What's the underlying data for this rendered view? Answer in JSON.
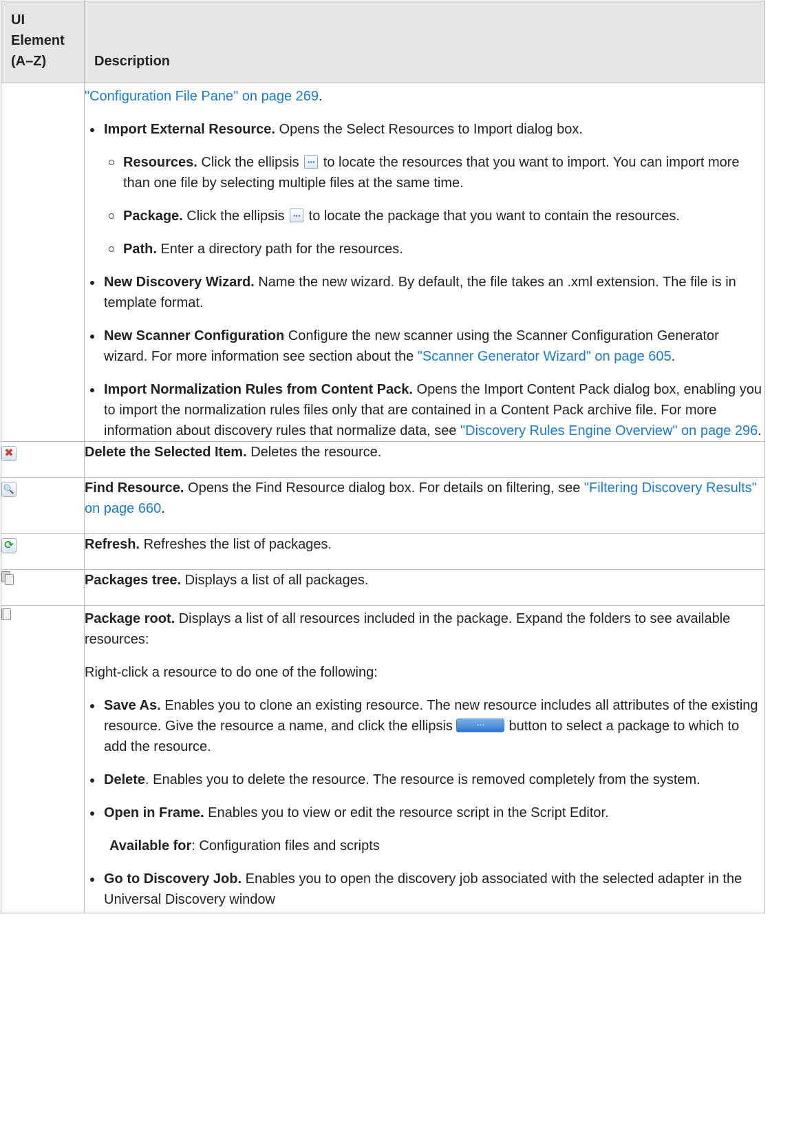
{
  "header": {
    "col1": "UI Element (A–Z)",
    "col2": "Description"
  },
  "row1": {
    "intro_link": "\"Configuration File Pane\" on page 269",
    "intro_tail": ".",
    "items": [
      {
        "label": "Import External Resource.",
        "text": " Opens the Select Resources to Import dialog box.",
        "subitems": [
          {
            "label": "Resources.",
            "pre": " Click the ellipsis ",
            "post": " to locate the resources that you want to import. You can import more than one file by selecting multiple files at the same time."
          },
          {
            "label": "Package.",
            "pre": " Click the ellipsis ",
            "post": " to locate the package that you want to contain the resources."
          },
          {
            "label": "Path.",
            "text": " Enter a directory path for the resources."
          }
        ]
      },
      {
        "label": "New Discovery Wizard.",
        "text": " Name the new wizard. By default, the file takes an .xml extension. The file is in template format."
      },
      {
        "label": "New Scanner Configuration",
        "text": " Configure the new scanner using the Scanner Configuration Generator wizard. For more information see section about the ",
        "link": "\"Scanner Generator Wizard\" on page 605",
        "tail": "."
      },
      {
        "label": "Import Normalization Rules from Content Pack.",
        "text": " Opens the Import Content Pack dialog box, enabling you to import the normalization rules files only that are contained in a Content Pack archive file. For more information about discovery rules that normalize data, see ",
        "link": "\"Discovery Rules Engine Overview\" on page 296",
        "tail": "."
      }
    ]
  },
  "row_delete": {
    "icon": "delete-icon",
    "label": "Delete the Selected Item.",
    "text": " Deletes the resource."
  },
  "row_find": {
    "icon": "find-icon",
    "label": "Find Resource.",
    "text": " Opens the Find Resource dialog box. For details on filtering, see ",
    "link": "\"Filtering Discovery Results\" on page 660",
    "tail": "."
  },
  "row_refresh": {
    "icon": "refresh-icon",
    "label": "Refresh.",
    "text": " Refreshes the list of packages."
  },
  "row_packages_tree": {
    "icon": "packages-tree-icon",
    "label": "Packages tree.",
    "text": " Displays a list of all packages."
  },
  "row_package_root": {
    "icon": "package-root-icon",
    "label": "Package root.",
    "text": " Displays a list of all resources included in the package. Expand the folders to see available resources:",
    "intro2": "Right-click a resource to do one of the following:",
    "items": [
      {
        "label": "Save As.",
        "pre": " Enables you to clone an existing resource. The new resource includes all attributes of the existing resource. Give the resource a name, and click the ellipsis ",
        "post": "button to select a package to which to add the resource."
      },
      {
        "label": "Delete",
        "text": ". Enables you to delete the resource. The resource is removed completely from the system."
      },
      {
        "label": "Open in Frame.",
        "text": " Enables you to view or edit the resource script in the Script Editor.",
        "avail_label": "Available for",
        "avail_text": ": Configuration files and scripts"
      },
      {
        "label": "Go to Discovery Job.",
        "text": " Enables you to open the discovery job associated with the selected adapter in the Universal Discovery window"
      }
    ]
  }
}
